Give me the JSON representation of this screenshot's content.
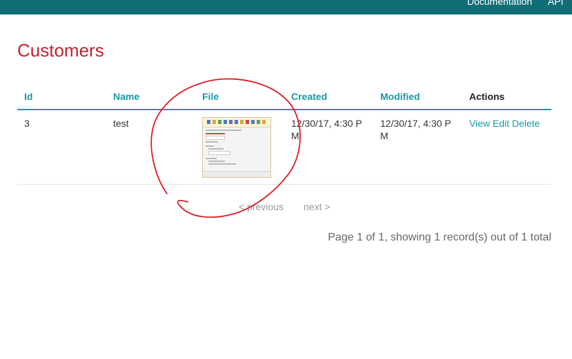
{
  "topnav": {
    "documentation": "Documentation",
    "api": "API"
  },
  "page": {
    "title": "Customers"
  },
  "table": {
    "headers": [
      "Id",
      "Name",
      "File",
      "Created",
      "Modified",
      "Actions"
    ],
    "rows": [
      {
        "id": "3",
        "name": "test",
        "file": "screenshot thumbnail",
        "created": "12/30/17, 4:30 PM",
        "modified": "12/30/17, 4:30 PM",
        "actions": [
          "View",
          "Edit",
          "Delete"
        ]
      }
    ]
  },
  "pagination": {
    "prev": "< previous",
    "next": "next >",
    "counter": "Page 1 of 1, showing 1 record(s) out of 1 total"
  },
  "colors": {
    "topbar": "#116d76",
    "title": "#c3232d",
    "link": "#1798a5",
    "annotation": "#e0191e"
  }
}
